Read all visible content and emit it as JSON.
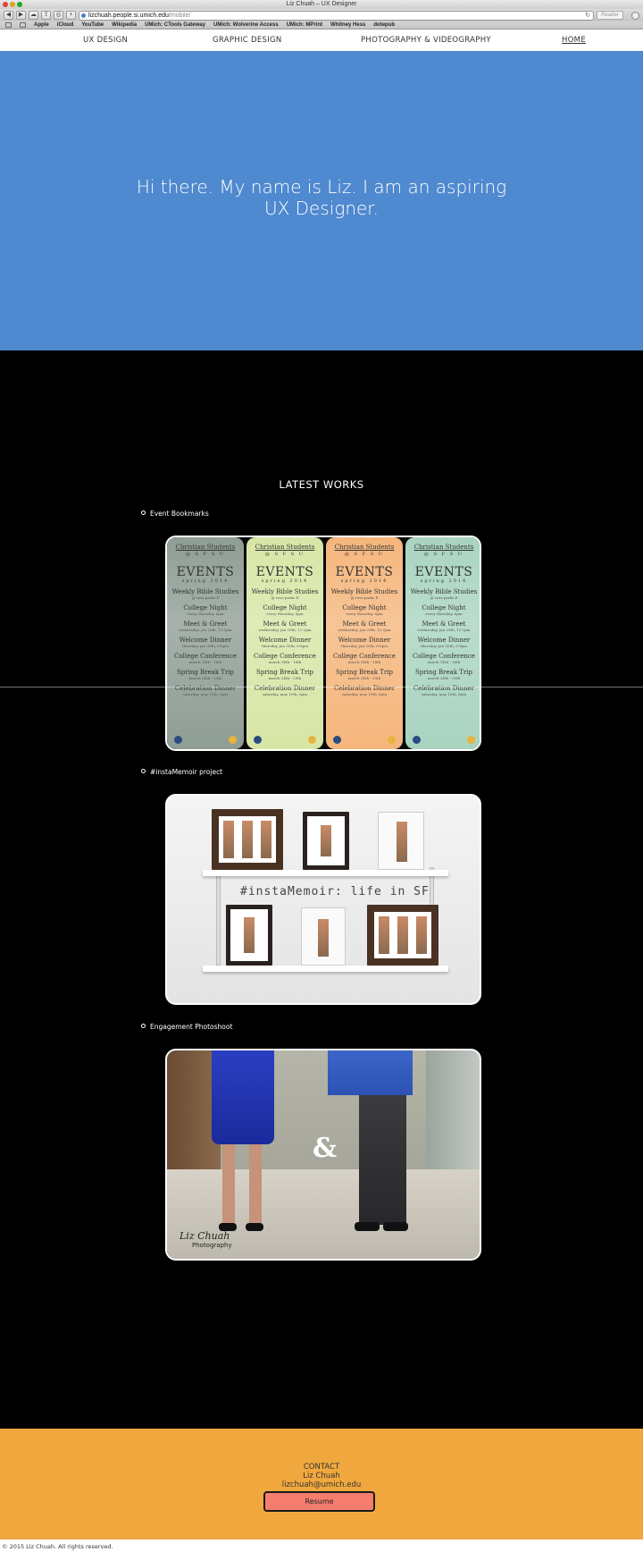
{
  "browser": {
    "window_title": "Liz Chuah – UX Designer",
    "url_host": "lizchuah.people.si.umich.edu",
    "url_path": "/mobile/",
    "reader_label": "Reader",
    "bookmarks": [
      "Apple",
      "iCloud",
      "YouTube",
      "Wikipedia",
      "UMich: CTools Gateway",
      "UMich: Wolverine Access",
      "UMich: MPrint",
      "Whitney Hess",
      "dotepub"
    ]
  },
  "nav": {
    "ux": "UX DESIGN",
    "graphic": "GRAPHIC DESIGN",
    "photo": "PHOTOGRAPHY & VIDEOGRAPHY",
    "home": "HOME"
  },
  "hero": {
    "line1": "Hi there. My name is Liz. I am an aspiring",
    "line2": "UX Designer."
  },
  "works": {
    "title": "LATEST WORKS",
    "items": [
      {
        "label": "Event Bookmarks"
      },
      {
        "label": "#instaMemoir project"
      },
      {
        "label": "Engagement Photoshoot"
      }
    ],
    "bookmark_card": {
      "org": "Christian Students",
      "org_sub": "@ S F S U",
      "heading": "EVENTS",
      "season": "spring 2014",
      "events": [
        {
          "name": "Weekly Bible Studies",
          "detail": "@ rosa parks E"
        },
        {
          "name": "College Night",
          "detail": "every thursday, 6pm"
        },
        {
          "name": "Meet & Greet",
          "detail": "wednesday, jan 29th, 12-2pm"
        },
        {
          "name": "Welcome Dinner",
          "detail": "thursday, jan 30th, 6-8pm"
        },
        {
          "name": "College Conference",
          "detail": "march 14th - 16th"
        },
        {
          "name": "Spring Break Trip",
          "detail": "march 24th - 29th"
        },
        {
          "name": "Celebration Dinner",
          "detail": "saturday, may 10th, 6pm"
        }
      ],
      "colors": [
        "#8f9e95",
        "#d7e6a6",
        "#f5b67c",
        "#a9d4c0"
      ]
    },
    "memoir_caption": "#instaMemoir: life in SF",
    "engagement": {
      "signature": "Liz Chuah",
      "signature_sub": "Photography",
      "amp": "&"
    }
  },
  "footer": {
    "contact_label": "CONTACT",
    "name": "Liz Chuah",
    "email": "lizchuah@umich.edu",
    "resume": "Resume",
    "copyright": "© 2015 Liz Chuah. All rights reserved."
  }
}
